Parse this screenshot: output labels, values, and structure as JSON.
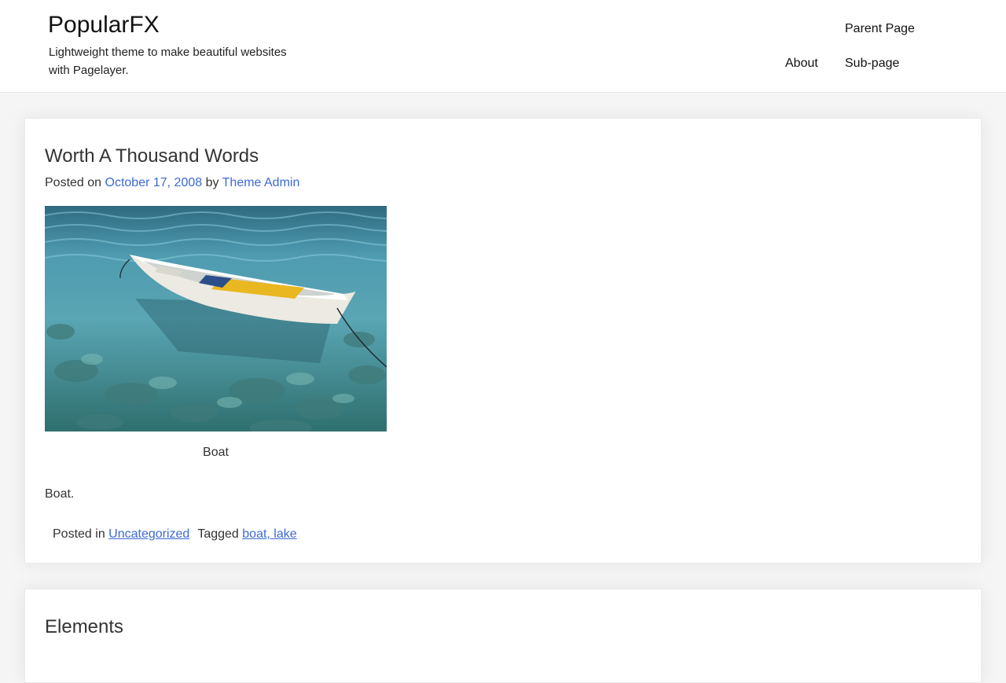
{
  "header": {
    "site_title": "PopularFX",
    "tagline": "Lightweight theme to make beautiful websites with Pagelayer.",
    "nav": {
      "parent_page": "Parent Page",
      "about": "About",
      "sub_page": "Sub-page"
    }
  },
  "post": {
    "title": "Worth A Thousand Words",
    "meta": {
      "posted_on": "Posted on ",
      "date": "October 17, 2008",
      "by": " by ",
      "author": "Theme Admin"
    },
    "image": {
      "icon": "boat-photo",
      "caption": "Boat"
    },
    "content": "Boat.",
    "footer": {
      "posted_in": "Posted in ",
      "category": "Uncategorized",
      "tagged": "Tagged ",
      "tag_1": "boat",
      "tag_sep": ", ",
      "tag_2": "lake"
    }
  },
  "next_post": {
    "title": "Elements"
  },
  "colors": {
    "link": "#3d6ad6",
    "page_background": "#f5f5f5",
    "card_background": "#ffffff",
    "text": "#333333"
  }
}
